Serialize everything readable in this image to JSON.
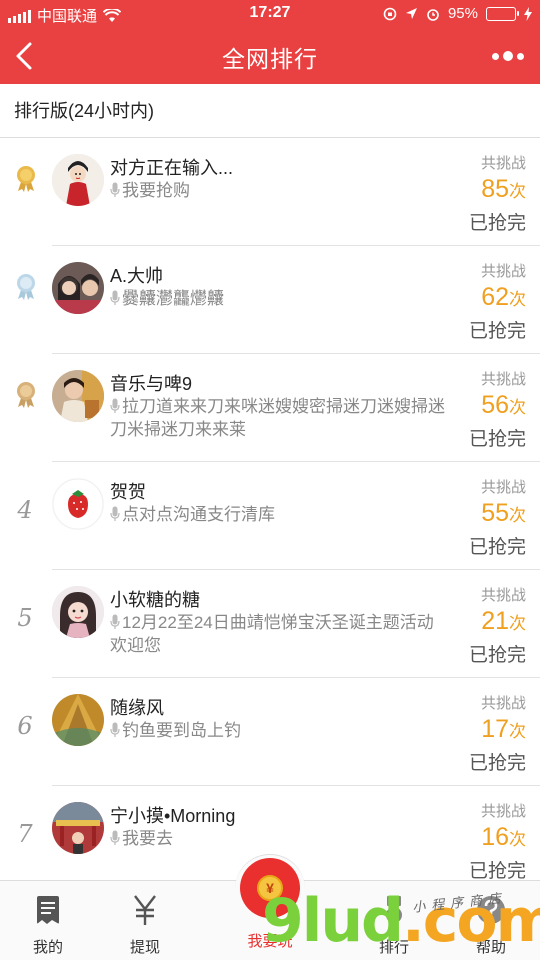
{
  "status_bar": {
    "carrier": "中国联通",
    "time": "17:27",
    "battery": "95%"
  },
  "nav": {
    "title": "全网排行"
  },
  "section": {
    "title": "排行版(24小时内)"
  },
  "common": {
    "total_label": "共挑战",
    "unit": "次",
    "status": "已抢完"
  },
  "rows": [
    {
      "rank": "",
      "medal": "gold",
      "name": "对方正在输入...",
      "message": "我要抢购",
      "count": "85"
    },
    {
      "rank": "",
      "medal": "silver",
      "name": "A.大帅",
      "message": "爨齉灪龘爩齉",
      "count": "62"
    },
    {
      "rank": "",
      "medal": "bronze",
      "name": "音乐与啤9",
      "message": "拉刀道来来刀来咪迷嫂嫂密掃迷刀迷嫂掃迷刀米掃迷刀来来莱",
      "count": "56"
    },
    {
      "rank": "4",
      "medal": "",
      "name": "贺贺",
      "message": "点对点沟通支行清库",
      "count": "55"
    },
    {
      "rank": "5",
      "medal": "",
      "name": "小软糖的糖",
      "message": "12月22至24日曲靖恺悌宝沃圣诞主题活动欢迎您",
      "count": "21"
    },
    {
      "rank": "6",
      "medal": "",
      "name": "随缘风",
      "message": "钓鱼要到岛上钓",
      "count": "17"
    },
    {
      "rank": "7",
      "medal": "",
      "name": "宁小摸•Morning",
      "message": "我要去",
      "count": "16"
    }
  ],
  "tabbar": {
    "mine": "我的",
    "withdraw": "提现",
    "play": "我要玩",
    "ranking": "排行",
    "help": "帮助",
    "coin_glyph": "¥"
  },
  "watermark": {
    "brand_a": "9lud",
    "brand_b": ".com",
    "small": "小程序商店"
  },
  "colors": {
    "accent": "#e94141",
    "count": "#f0a020",
    "battery": "#4cd964"
  }
}
